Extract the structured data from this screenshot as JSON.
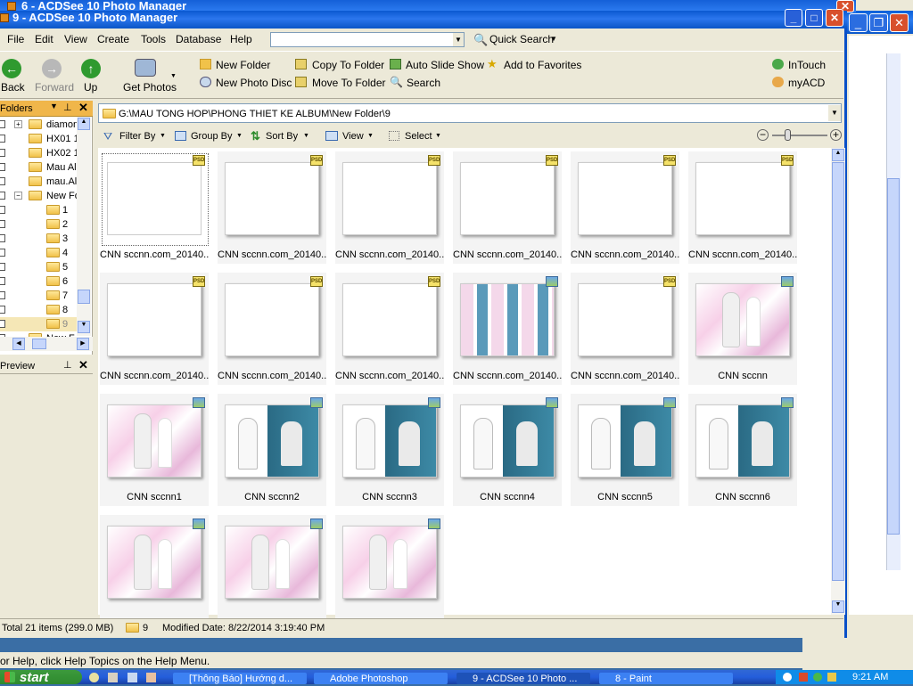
{
  "window": {
    "title_back": "6 - ACDSee 10 Photo Manager",
    "title_front": "9 - ACDSee 10 Photo Manager"
  },
  "menu": [
    "File",
    "Edit",
    "View",
    "Create",
    "Tools",
    "Database",
    "Help"
  ],
  "quick_search": {
    "value": "",
    "label": "Quick Search"
  },
  "toolbar": {
    "back": "Back",
    "forward": "Forward",
    "up": "Up",
    "get_photos": "Get Photos",
    "new_folder": "New Folder",
    "new_photo_disc": "New Photo Disc",
    "copy_to_folder": "Copy To Folder",
    "move_to_folder": "Move To Folder",
    "auto_slide_show": "Auto Slide Show",
    "search": "Search",
    "add_to_favorites": "Add to Favorites",
    "intouch": "InTouch",
    "myacd": "myACD"
  },
  "folders_panel": {
    "title": "Folders",
    "items": [
      {
        "label": "diamon",
        "indent": 1
      },
      {
        "label": "HX01 1",
        "indent": 1
      },
      {
        "label": "HX02 1",
        "indent": 1
      },
      {
        "label": "Mau Al",
        "indent": 1
      },
      {
        "label": "mau.Al",
        "indent": 1
      },
      {
        "label": "New Fo",
        "indent": 1
      },
      {
        "label": "1",
        "indent": 2
      },
      {
        "label": "2",
        "indent": 2
      },
      {
        "label": "3",
        "indent": 2
      },
      {
        "label": "4",
        "indent": 2
      },
      {
        "label": "5",
        "indent": 2
      },
      {
        "label": "6",
        "indent": 2
      },
      {
        "label": "7",
        "indent": 2
      },
      {
        "label": "8",
        "indent": 2
      },
      {
        "label": "9",
        "indent": 2
      },
      {
        "label": "New F",
        "indent": 1
      }
    ]
  },
  "preview_panel": {
    "title": "Preview"
  },
  "path": "G:\\MAU TONG HOP\\PHONG THIET KE ALBUM\\New Folder\\9",
  "browse_toolbar": {
    "filter": "Filter By",
    "group": "Group By",
    "sort": "Sort By",
    "view": "View",
    "select": "Select"
  },
  "files": [
    {
      "name": "CNN sccnn.com_20140...",
      "type": "psd",
      "img": "blank"
    },
    {
      "name": "CNN sccnn.com_20140...",
      "type": "psd",
      "img": "blank"
    },
    {
      "name": "CNN sccnn.com_20140...",
      "type": "psd",
      "img": "blank"
    },
    {
      "name": "CNN sccnn.com_20140...",
      "type": "psd",
      "img": "blank"
    },
    {
      "name": "CNN sccnn.com_20140...",
      "type": "psd",
      "img": "blank"
    },
    {
      "name": "CNN sccnn.com_20140...",
      "type": "psd",
      "img": "blank"
    },
    {
      "name": "CNN sccnn.com_20140...",
      "type": "psd",
      "img": "blank"
    },
    {
      "name": "CNN sccnn.com_20140...",
      "type": "psd",
      "img": "blank"
    },
    {
      "name": "CNN sccnn.com_20140...",
      "type": "psd",
      "img": "blank"
    },
    {
      "name": "CNN sccnn.com_20140...",
      "type": "jpg",
      "img": "collage"
    },
    {
      "name": "CNN sccnn.com_20140...",
      "type": "psd",
      "img": "blank"
    },
    {
      "name": "CNN sccnn",
      "type": "jpg",
      "img": "pink"
    },
    {
      "name": "CNN sccnn1",
      "type": "jpg",
      "img": "pink"
    },
    {
      "name": "CNN sccnn2",
      "type": "jpg",
      "img": "teal"
    },
    {
      "name": "CNN sccnn3",
      "type": "jpg",
      "img": "teal"
    },
    {
      "name": "CNN sccnn4",
      "type": "jpg",
      "img": "teal"
    },
    {
      "name": "CNN sccnn5",
      "type": "jpg",
      "img": "teal"
    },
    {
      "name": "CNN sccnn6",
      "type": "jpg",
      "img": "teal"
    },
    {
      "name": "",
      "type": "jpg",
      "img": "pink"
    },
    {
      "name": "",
      "type": "jpg",
      "img": "pink"
    },
    {
      "name": "",
      "type": "jpg",
      "img": "pink"
    }
  ],
  "status": {
    "total": "Total 21 items  (299.0 MB)",
    "folder": "9",
    "modified": "Modified Date: 8/22/2014 3:19:40 PM"
  },
  "help_text": "or Help, click Help Topics on the Help Menu.",
  "taskbar": {
    "start": "start",
    "tasks": [
      "[Thông Báo] Hướng d...",
      "Adobe Photoshop",
      "9 - ACDSee 10 Photo ...",
      "8 - Paint"
    ],
    "clock": "9:21 AM"
  },
  "colors": {
    "title_blue": "#0a58d0",
    "taskbar_blue": "#245edb",
    "start_green": "#2e8a2e",
    "folders_header": "#f0b64a"
  }
}
